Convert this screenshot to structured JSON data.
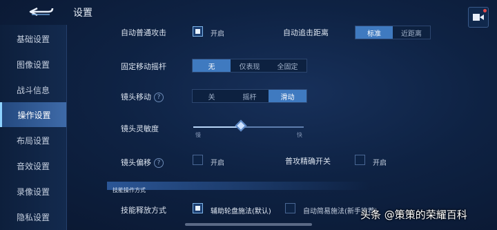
{
  "header": {
    "title": "设置"
  },
  "sidebar": {
    "items": [
      {
        "label": "基础设置"
      },
      {
        "label": "图像设置"
      },
      {
        "label": "战斗信息"
      },
      {
        "label": "操作设置"
      },
      {
        "label": "布局设置"
      },
      {
        "label": "音效设置"
      },
      {
        "label": "录像设置"
      },
      {
        "label": "隐私设置"
      }
    ],
    "active_index": 3
  },
  "settings": {
    "auto_attack": {
      "label": "自动普通攻击",
      "checkbox_label": "开启",
      "checked": true
    },
    "auto_chase": {
      "label": "自动追击距离",
      "options": [
        "标准",
        "近距离"
      ],
      "selected": "标准"
    },
    "joystick": {
      "label": "固定移动摇杆",
      "options": [
        "无",
        "仅表现",
        "全固定"
      ],
      "selected": "无"
    },
    "camera_move": {
      "label": "镜头移动",
      "help": "?",
      "options": [
        "关",
        "摇杆",
        "滑动"
      ],
      "selected": "滑动"
    },
    "sensitivity": {
      "label": "镜头灵敏度",
      "min_label": "慢",
      "max_label": "快",
      "value": 0.43
    },
    "camera_offset": {
      "label": "镜头偏移",
      "help": "?",
      "checkbox_label": "开启",
      "checked": false
    },
    "precise_attack": {
      "label": "普攻精确开关",
      "checkbox_label": "开启",
      "checked": false
    },
    "section": {
      "label": "技能操作方式"
    },
    "skill_release": {
      "label": "技能释放方式",
      "option_a": "辅助轮盘施法(默认)",
      "option_a_checked": true,
      "option_b": "自动简易施法(新手推荐)",
      "option_b_checked": false
    }
  },
  "watermark": {
    "text": "头条 @策策的荣耀百科"
  }
}
